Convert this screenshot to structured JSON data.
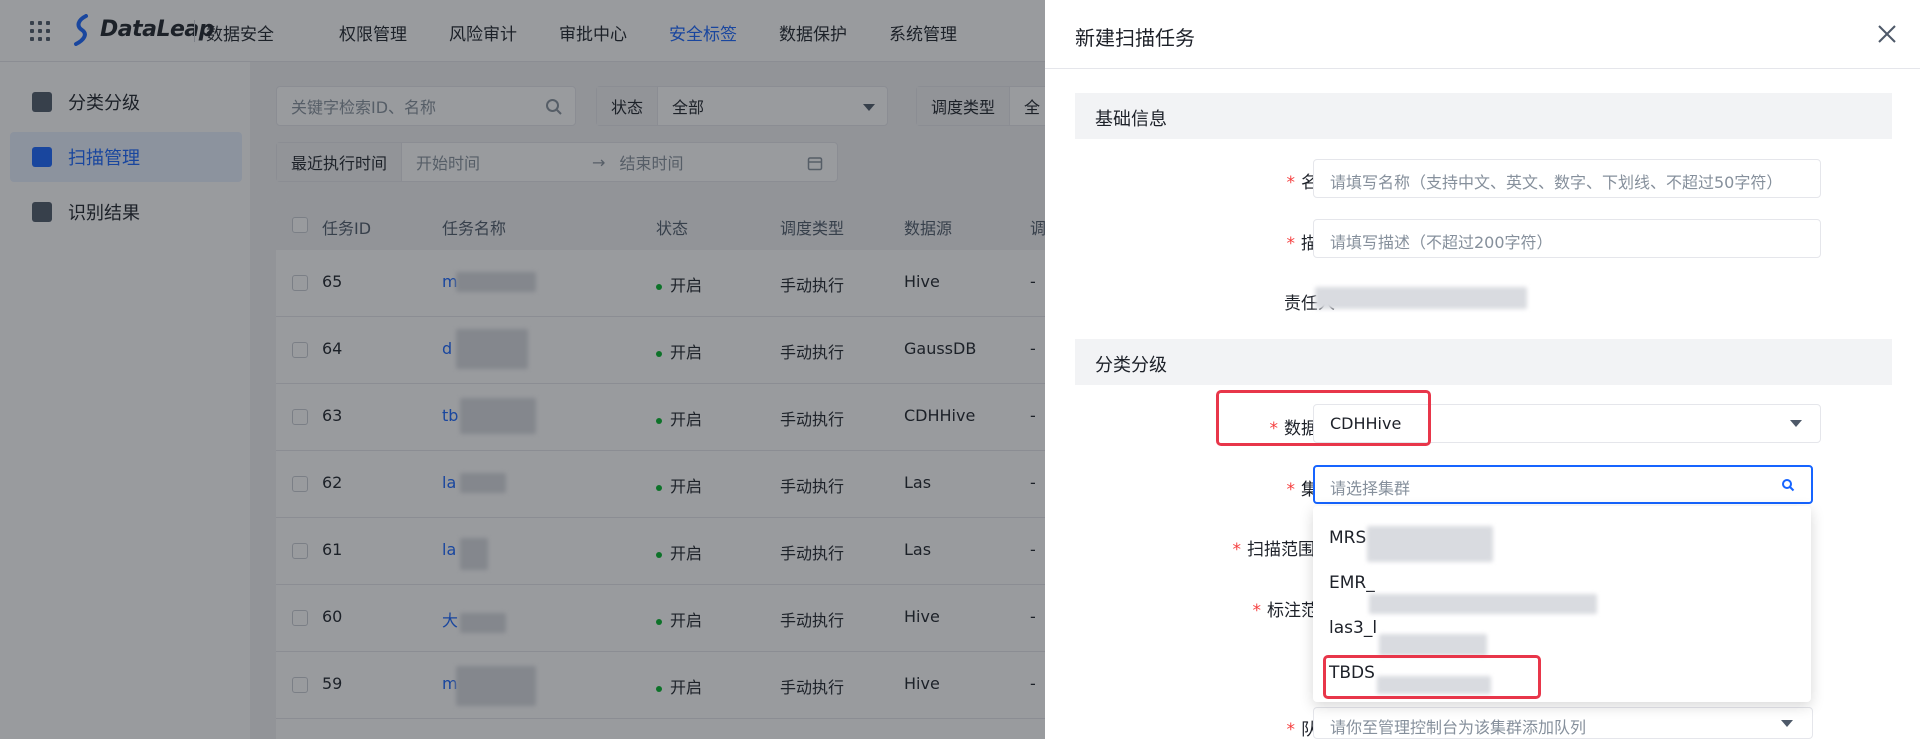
{
  "topbar": {
    "logo_text": "DataLeap",
    "product": "数据安全",
    "nav": [
      "权限管理",
      "风险审计",
      "审批中心",
      "安全标签",
      "数据保护",
      "系统管理"
    ],
    "active_index": 3
  },
  "sidebar": {
    "items": [
      {
        "label": "分类分级",
        "icon": "classify-icon"
      },
      {
        "label": "扫描管理",
        "icon": "calendar-icon",
        "active": true
      },
      {
        "label": "识别结果",
        "icon": "result-icon"
      }
    ]
  },
  "filters": {
    "search_placeholder": "关键字检索ID、名称",
    "status_label": "状态",
    "status_value": "全部",
    "schedule_label": "调度类型",
    "schedule_value": "全",
    "recent_label": "最近执行时间",
    "start_placeholder": "开始时间",
    "end_placeholder": "结束时间",
    "arrow": "→"
  },
  "table": {
    "headers": [
      "任务ID",
      "任务名称",
      "状态",
      "调度类型",
      "数据源",
      "调"
    ],
    "rows": [
      {
        "id": "65",
        "name": "m",
        "status": "开启",
        "schedule": "手动执行",
        "source": "Hive",
        "extra": "-"
      },
      {
        "id": "64",
        "name": "d",
        "status": "开启",
        "schedule": "手动执行",
        "source": "GaussDB",
        "extra": "-"
      },
      {
        "id": "63",
        "name": "tb",
        "status": "开启",
        "schedule": "手动执行",
        "source": "CDHHive",
        "extra": "-"
      },
      {
        "id": "62",
        "name": "la",
        "status": "开启",
        "schedule": "手动执行",
        "source": "Las",
        "extra": "-"
      },
      {
        "id": "61",
        "name": "la",
        "status": "开启",
        "schedule": "手动执行",
        "source": "Las",
        "extra": "-"
      },
      {
        "id": "60",
        "name": "大",
        "status": "开启",
        "schedule": "手动执行",
        "source": "Hive",
        "extra": "-"
      },
      {
        "id": "59",
        "name": "m",
        "status": "开启",
        "schedule": "手动执行",
        "source": "Hive",
        "extra": "-"
      }
    ]
  },
  "drawer": {
    "title": "新建扫描任务",
    "section_basic": "基础信息",
    "section_classify": "分类分级",
    "name_label": "名称",
    "name_placeholder": "请填写名称（支持中文、英文、数字、下划线、不超过50字符）",
    "desc_label": "描述",
    "desc_placeholder": "请填写描述（不超过200字符）",
    "owner_label": "责任人",
    "source_label": "数据源",
    "source_value": "CDHHive",
    "cluster_label": "集群",
    "cluster_placeholder": "请选择集群",
    "scope_label": "扫描范围",
    "mark_label": "标注范围",
    "queue_label": "队列",
    "queue_placeholder": "请你至管理控制台为该集群添加队列",
    "required_mark": "*"
  },
  "dropdown": {
    "options": [
      "MRS",
      "EMR_",
      "las3_l",
      "TBDS"
    ]
  },
  "colors": {
    "primary": "#1664ff",
    "highlight": "#e8364a",
    "status_on": "#00b42a"
  }
}
